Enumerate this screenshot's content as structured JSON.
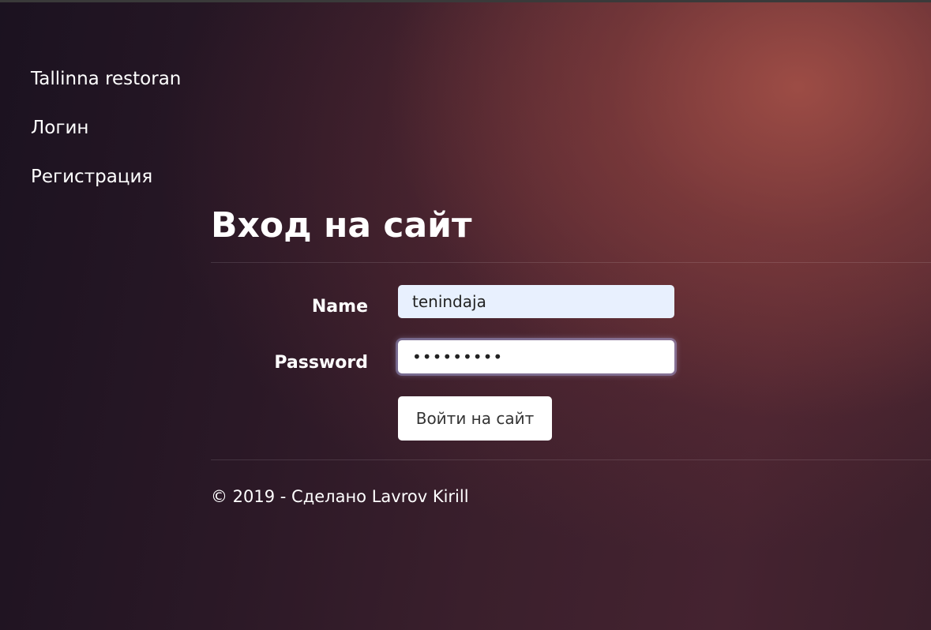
{
  "nav": {
    "brand": "Tallinna restoran",
    "items": [
      {
        "label": "Логин"
      },
      {
        "label": "Регистрация"
      }
    ]
  },
  "main": {
    "title": "Вход на сайт",
    "form": {
      "name_label": "Name",
      "name_value": "tenindaja",
      "password_label": "Password",
      "password_value": "•••••••••",
      "submit_label": "Войти на сайт"
    }
  },
  "footer": {
    "text": "© 2019 - Сделано Lavrov Kirill"
  },
  "colors": {
    "autofill_bg": "#e8f0fe",
    "text": "#ffffff",
    "accent_glow": "#a04e46"
  }
}
